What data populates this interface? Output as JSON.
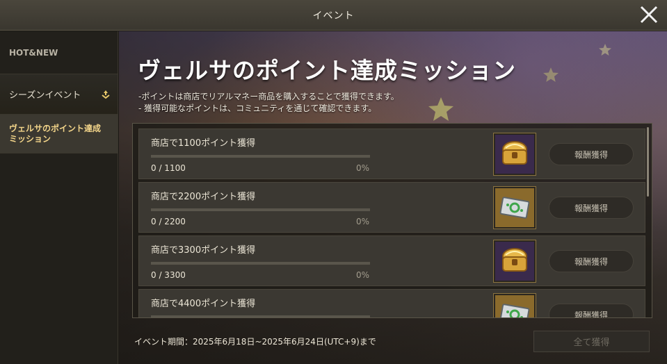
{
  "window": {
    "title": "イベント"
  },
  "sidebar": {
    "category": "HOT&NEW",
    "items": [
      {
        "label": "シーズンイベント"
      },
      {
        "label": "ヴェルサのポイント達成ミッション"
      }
    ]
  },
  "main": {
    "headline": "ヴェルサのポイント達成ミッション",
    "desc_lines": [
      "-ポイントは商店でリアルマネー商品を購入することで獲得できます。",
      "- 獲得可能なポイントは、コミュニティを通じて確認できます。"
    ],
    "missions": [
      {
        "title": "商店で1100ポイント獲得",
        "progress": "0 / 1100",
        "percent": "0%",
        "progress_fraction": 0,
        "reward_icon": "golden-chest-icon",
        "claim_label": "報酬獲得"
      },
      {
        "title": "商店で2200ポイント獲得",
        "progress": "0 / 2200",
        "percent": "0%",
        "progress_fraction": 0,
        "reward_icon": "ticket-icon",
        "claim_label": "報酬獲得"
      },
      {
        "title": "商店で3300ポイント獲得",
        "progress": "0 / 3300",
        "percent": "0%",
        "progress_fraction": 0,
        "reward_icon": "golden-chest-icon",
        "claim_label": "報酬獲得"
      },
      {
        "title": "商店で4400ポイント獲得",
        "progress": "",
        "percent": "",
        "progress_fraction": 0,
        "reward_icon": "ticket-icon",
        "claim_label": "報酬獲得"
      }
    ],
    "period": "イベント期間：2025年6月18日~2025年6月24日(UTC+9)まで",
    "claim_all_label": "全て獲得"
  },
  "colors": {
    "accent_gold": "#f3d58a",
    "progress_fill": "#d6b25e"
  }
}
